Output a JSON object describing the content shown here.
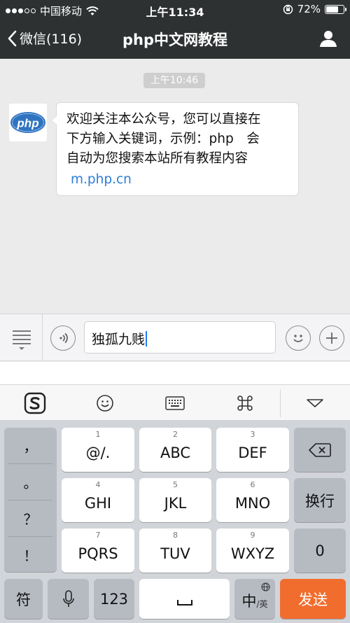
{
  "status_bar": {
    "carrier": "中国移动",
    "time": "上午11:34",
    "battery_text": "72%",
    "battery_level": 0.72
  },
  "nav": {
    "back_label": "微信(116)",
    "title": "php中文网教程"
  },
  "chat": {
    "timestamp": "上午10:46",
    "avatar_text": "php",
    "message_line1": "欢迎关注本公众号，您可以直接在",
    "message_line2": "下方输入关键词，示例：php　会",
    "message_line3": "自动为您搜索本站所有教程内容",
    "message_link": "m.php.cn"
  },
  "input": {
    "text": "独孤九贱"
  },
  "keyboard": {
    "punctuation": [
      "，",
      "。",
      "？",
      "！"
    ],
    "keys": [
      {
        "num": "1",
        "label": "@/."
      },
      {
        "num": "2",
        "label": "ABC"
      },
      {
        "num": "3",
        "label": "DEF"
      },
      {
        "num": "4",
        "label": "GHI"
      },
      {
        "num": "5",
        "label": "JKL"
      },
      {
        "num": "6",
        "label": "MNO"
      },
      {
        "num": "7",
        "label": "PQRS"
      },
      {
        "num": "8",
        "label": "TUV"
      },
      {
        "num": "9",
        "label": "WXYZ"
      }
    ],
    "newline_label": "换行",
    "zero_label": "0",
    "symbol_label": "符",
    "digits_label": "123",
    "lang_main": "中",
    "lang_sub": "/英",
    "send_label": "发送"
  },
  "colors": {
    "nav_bg": "#2e3132",
    "link": "#2d7ed9",
    "send_key": "#f16d2e",
    "caret": "#1c7ef5"
  }
}
